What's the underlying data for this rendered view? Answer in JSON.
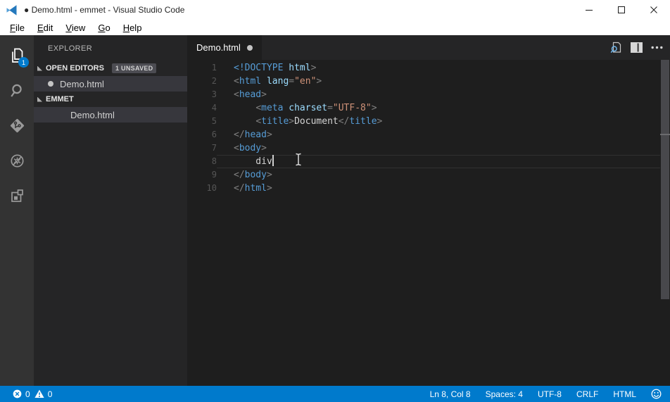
{
  "window": {
    "title": "● Demo.html - emmet - Visual Studio Code",
    "controls": [
      {
        "name": "minimize",
        "icon": "minimize"
      },
      {
        "name": "maximize",
        "icon": "maximize"
      },
      {
        "name": "close",
        "icon": "close"
      }
    ]
  },
  "menu": {
    "items": [
      "File",
      "Edit",
      "View",
      "Go",
      "Help"
    ]
  },
  "activity_bar": {
    "items": [
      {
        "name": "explorer",
        "icon": "files",
        "active": true,
        "badge": "1"
      },
      {
        "name": "search",
        "icon": "search",
        "active": false
      },
      {
        "name": "source-control",
        "icon": "source-control",
        "active": false
      },
      {
        "name": "debug",
        "icon": "debug",
        "active": false
      },
      {
        "name": "extensions",
        "icon": "extensions",
        "active": false
      }
    ]
  },
  "sidebar": {
    "title": "EXPLORER",
    "sections": [
      {
        "label": "OPEN EDITORS",
        "badge": "1 UNSAVED",
        "rows": [
          {
            "label": "Demo.html",
            "modified": true,
            "selected": true
          }
        ]
      },
      {
        "label": "EMMET",
        "badge": null,
        "rows": [
          {
            "label": "Demo.html",
            "modified": false,
            "selected": true
          }
        ]
      }
    ]
  },
  "editor": {
    "tab": {
      "label": "Demo.html",
      "modified": true
    },
    "actions": [
      {
        "name": "open-preview",
        "icon": "open-preview"
      },
      {
        "name": "split-editor",
        "icon": "split-editor"
      },
      {
        "name": "more-actions",
        "icon": "more"
      }
    ],
    "code": {
      "lines": [
        {
          "n": "1",
          "tokens": [
            [
              "kw",
              "<!DOCTYPE "
            ],
            [
              "attr",
              "html"
            ],
            [
              "pun",
              ">"
            ]
          ]
        },
        {
          "n": "2",
          "tokens": [
            [
              "pun",
              "<"
            ],
            [
              "tag",
              "html"
            ],
            [
              "plain",
              " "
            ],
            [
              "attr",
              "lang"
            ],
            [
              "pun",
              "="
            ],
            [
              "str",
              "\"en\""
            ],
            [
              "pun",
              ">"
            ]
          ]
        },
        {
          "n": "3",
          "tokens": [
            [
              "pun",
              "<"
            ],
            [
              "tag",
              "head"
            ],
            [
              "pun",
              ">"
            ]
          ]
        },
        {
          "n": "4",
          "tokens": [
            [
              "plain",
              "    "
            ],
            [
              "pun",
              "<"
            ],
            [
              "tag",
              "meta"
            ],
            [
              "plain",
              " "
            ],
            [
              "attr",
              "charset"
            ],
            [
              "pun",
              "="
            ],
            [
              "str",
              "\"UTF-8\""
            ],
            [
              "pun",
              ">"
            ]
          ]
        },
        {
          "n": "5",
          "tokens": [
            [
              "plain",
              "    "
            ],
            [
              "pun",
              "<"
            ],
            [
              "tag",
              "title"
            ],
            [
              "pun",
              ">"
            ],
            [
              "plain",
              "Document"
            ],
            [
              "pun",
              "</"
            ],
            [
              "tag",
              "title"
            ],
            [
              "pun",
              ">"
            ]
          ]
        },
        {
          "n": "6",
          "tokens": [
            [
              "pun",
              "</"
            ],
            [
              "tag",
              "head"
            ],
            [
              "pun",
              ">"
            ]
          ]
        },
        {
          "n": "7",
          "tokens": [
            [
              "pun",
              "<"
            ],
            [
              "tag",
              "body"
            ],
            [
              "pun",
              ">"
            ]
          ]
        },
        {
          "n": "8",
          "tokens": [
            [
              "plain",
              "    div"
            ]
          ],
          "current": true,
          "cursor": true
        },
        {
          "n": "9",
          "tokens": [
            [
              "pun",
              "</"
            ],
            [
              "tag",
              "body"
            ],
            [
              "pun",
              ">"
            ]
          ]
        },
        {
          "n": "10",
          "tokens": [
            [
              "pun",
              "</"
            ],
            [
              "tag",
              "html"
            ],
            [
              "pun",
              ">"
            ]
          ]
        }
      ]
    }
  },
  "status_bar": {
    "left": [
      {
        "name": "errors",
        "icon": "error",
        "value": "0"
      },
      {
        "name": "warnings",
        "icon": "warning",
        "value": "0"
      }
    ],
    "right": [
      {
        "name": "cursor-position",
        "label": "Ln 8, Col 8"
      },
      {
        "name": "indentation",
        "label": "Spaces: 4"
      },
      {
        "name": "encoding",
        "label": "UTF-8"
      },
      {
        "name": "eol",
        "label": "CRLF"
      },
      {
        "name": "language-mode",
        "label": "HTML"
      },
      {
        "name": "feedback",
        "icon": "smiley",
        "label": ""
      }
    ]
  },
  "colors": {
    "statusbar": "#007acc",
    "badge": "#007acc",
    "activitybar": "#333333",
    "sidebar": "#252526",
    "editor_bg": "#1e1e1e",
    "tag": "#569cd6",
    "attribute": "#9cdcfe",
    "string": "#ce9178",
    "punctuation": "#808080",
    "text": "#d4d4d4"
  }
}
